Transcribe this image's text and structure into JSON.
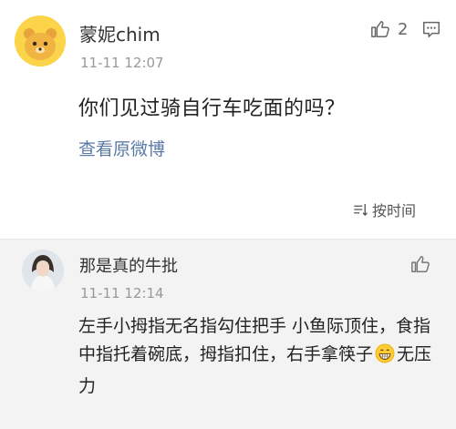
{
  "post": {
    "username": "蒙妮chim",
    "timestamp": "11-11 12:07",
    "like_count": "2",
    "text": "你们见过骑自行车吃面的吗？",
    "view_original_label": "查看原微博",
    "sort_label": "按时间"
  },
  "comment": {
    "username": "那是真的牛批",
    "timestamp": "11-11 12:14",
    "text_part1": "左手小拇指无名指勾住把手 小鱼际顶住，食指中指托着碗底，拇指扣住，右手拿筷子",
    "text_part2": "无压力",
    "emoji_name": "grin-emoji"
  },
  "icons": {
    "like": "thumbs-up-icon",
    "comment": "comment-icon",
    "sort": "sort-icon"
  },
  "colors": {
    "link": "#5b7aa6",
    "comment_bg": "#f3f3f3",
    "avatar_bear": "#fbd44a"
  }
}
